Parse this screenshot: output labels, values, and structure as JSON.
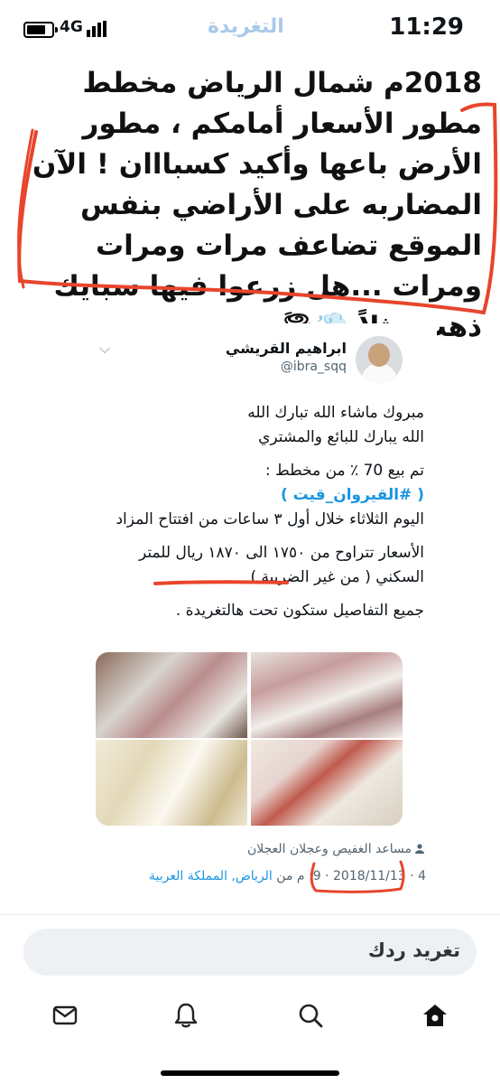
{
  "status_bar": {
    "network": "4G",
    "time": "11:29",
    "faded_title": "التغريدة"
  },
  "header_comment": "2018م شمال الرياض مخطط مطور الأسعار أمامكم ، مطور الأرض باعها وأكيد كسبااان ! الآن المضاربه على الأراضي بنفس الموقع تضاعف مرات ومرات ومرات ...هل زرعوا فيها سبايك ذهب مثلاً 💨🌪",
  "tweet": {
    "author_name": "ابراهيم القريشي",
    "author_handle": "@ibra_sqq",
    "lines": {
      "l1": "مبروك ماشاء الله تبارك الله",
      "l2": "الله يبارك للبائع والمشتري",
      "l3": "تم بيع 70 ٪ من مخطط :",
      "l4_hashtag": "( #القيروان_قيت )",
      "l5": "اليوم الثلاثاء خلال أول ٣ ساعات من افتتاح المزاد",
      "l6": "الأسعار تتراوح من ١٧٥٠ الى ١٨٧٠ ريال للمتر السكني ( من غير الضريبة )",
      "l7": "جميع التفاصيل ستكون تحت هالتغريدة ."
    },
    "retweeted_by": "مساعد الغفيص وعجلان العجلان",
    "meta": "4 · 2018/11/13 · 9:  م من الرياض, المملكة العربية",
    "meta_time": "9:",
    "meta_pm": "م من",
    "meta_location": "الرياض, المملكة العربية",
    "meta_date": "2018/11/13",
    "meta_num": "4"
  },
  "reply": {
    "placeholder": "تغريد ردك"
  },
  "tabbar": {
    "items": [
      "home-icon",
      "search-icon",
      "notifications-icon",
      "messages-icon"
    ]
  },
  "colors": {
    "link": "#1b95e0",
    "annotation": "#e8452c"
  }
}
